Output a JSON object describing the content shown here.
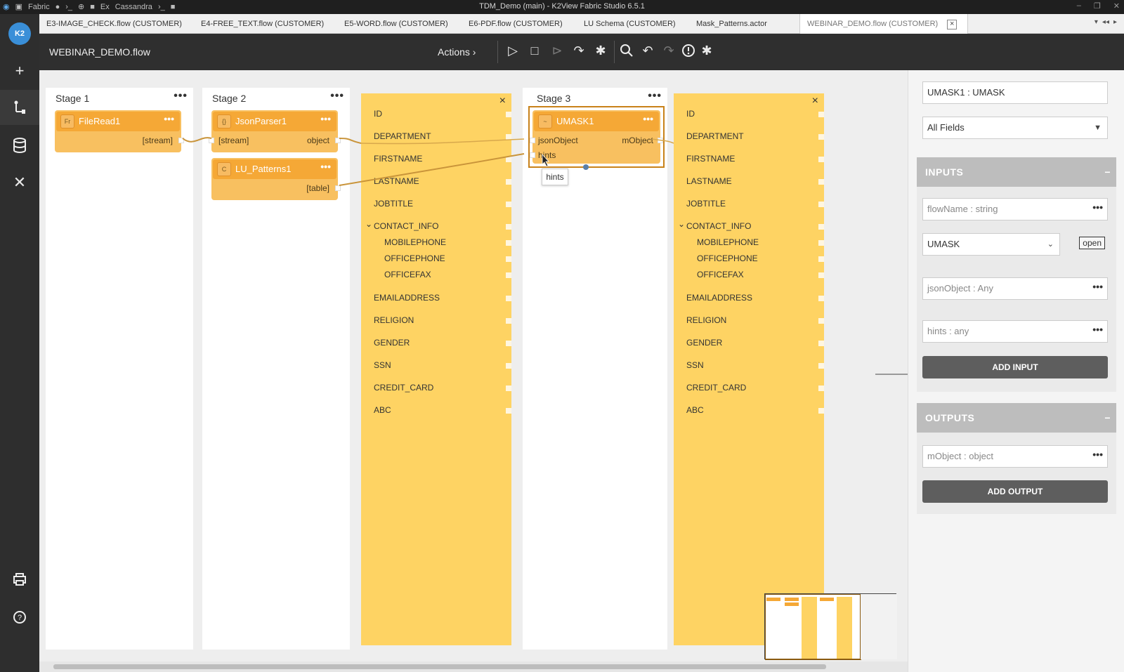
{
  "titlebar": {
    "app_name": "Fabric",
    "db_name": "Cassandra",
    "title": "TDM_Demo (main) - K2View Fabric Studio 6.5.1"
  },
  "sidebar": {
    "logo": "K2",
    "items": [
      {
        "name": "add-icon"
      },
      {
        "name": "flow-icon"
      },
      {
        "name": "database-icon"
      },
      {
        "name": "tools-icon"
      },
      {
        "name": "printer-icon"
      },
      {
        "name": "help-icon"
      }
    ]
  },
  "tabs": [
    {
      "label": "E3-IMAGE_CHECK.flow (CUSTOMER)"
    },
    {
      "label": "E4-FREE_TEXT.flow (CUSTOMER)"
    },
    {
      "label": "E5-WORD.flow (CUSTOMER)"
    },
    {
      "label": "E6-PDF.flow (CUSTOMER)"
    },
    {
      "label": "LU Schema (CUSTOMER)"
    },
    {
      "label": "Mask_Patterns.actor"
    },
    {
      "label": "WEBINAR_DEMO.flow (CUSTOMER)"
    }
  ],
  "tab_close": "×",
  "toolbar": {
    "flow_name": "WEBINAR_DEMO.flow",
    "actions_label": "Actions ›",
    "tools": [
      {
        "name": "run-icon",
        "glyph": "▷"
      },
      {
        "name": "stop-icon",
        "glyph": "□"
      },
      {
        "name": "step-icon",
        "glyph": "⊳"
      },
      {
        "name": "step-over-icon",
        "glyph": "↷"
      },
      {
        "name": "debug-icon",
        "glyph": "✱"
      },
      {
        "name": "search-icon",
        "glyph": "⌕"
      },
      {
        "name": "undo-icon",
        "glyph": "↶"
      },
      {
        "name": "redo-icon",
        "glyph": "↷"
      },
      {
        "name": "alert-icon",
        "glyph": "!"
      },
      {
        "name": "asterisk-icon",
        "glyph": "✱"
      }
    ]
  },
  "stages": [
    {
      "title": "Stage 1",
      "dots": "•••"
    },
    {
      "title": "Stage 2",
      "dots": "•••"
    },
    {
      "title": "Stage 3",
      "dots": "•••"
    }
  ],
  "actors": {
    "fileread": {
      "badge": "Fr",
      "name": "FileRead1",
      "dots": "•••",
      "out_port": "[stream]"
    },
    "jsonparser": {
      "badge": "{}",
      "name": "JsonParser1",
      "dots": "•••",
      "in_port": "[stream]",
      "out_port": "object"
    },
    "lupatterns": {
      "badge": "C",
      "name": "LU_Patterns1",
      "dots": "•••",
      "out_port": "[table]"
    },
    "umask": {
      "badge": "~",
      "name": "UMASK1",
      "dots": "•••",
      "in_port1": "jsonObject",
      "in_port2": "hints",
      "out_port": "mObject"
    }
  },
  "tooltip": "hints",
  "schema_close": "×",
  "schema_fields": [
    {
      "label": "ID",
      "indent": false
    },
    {
      "label": "DEPARTMENT",
      "indent": false
    },
    {
      "label": "FIRSTNAME",
      "indent": false
    },
    {
      "label": "LASTNAME",
      "indent": false
    },
    {
      "label": "JOBTITLE",
      "indent": false
    },
    {
      "label": "CONTACT_INFO",
      "indent": false,
      "expand": true
    },
    {
      "label": "MOBILEPHONE",
      "indent": true
    },
    {
      "label": "OFFICEPHONE",
      "indent": true
    },
    {
      "label": "OFFICEFAX",
      "indent": true
    },
    {
      "label": "EMAILADDRESS",
      "indent": false
    },
    {
      "label": "RELIGION",
      "indent": false
    },
    {
      "label": "GENDER",
      "indent": false
    },
    {
      "label": "SSN",
      "indent": false
    },
    {
      "label": "CREDIT_CARD",
      "indent": false
    },
    {
      "label": "ABC",
      "indent": false
    }
  ],
  "panel": {
    "actor_title": "UMASK1 : UMASK",
    "filter_value": "All Fields",
    "inputs_header": "INPUTS",
    "outputs_header": "OUTPUTS",
    "collapse": "−",
    "inputs": [
      {
        "label": "flowName : string"
      },
      {
        "label": "jsonObject : Any"
      },
      {
        "label": "hints : any"
      }
    ],
    "flow_select": "UMASK",
    "open_label": "open",
    "add_input": "ADD INPUT",
    "outputs": [
      {
        "label": "mObject : object"
      }
    ],
    "add_output": "ADD OUTPUT",
    "more": "•••"
  },
  "colors": {
    "actor": "#f5a836",
    "schema": "#fed363",
    "selected_border": "#c8821a",
    "accent": "#3a8fd8"
  }
}
